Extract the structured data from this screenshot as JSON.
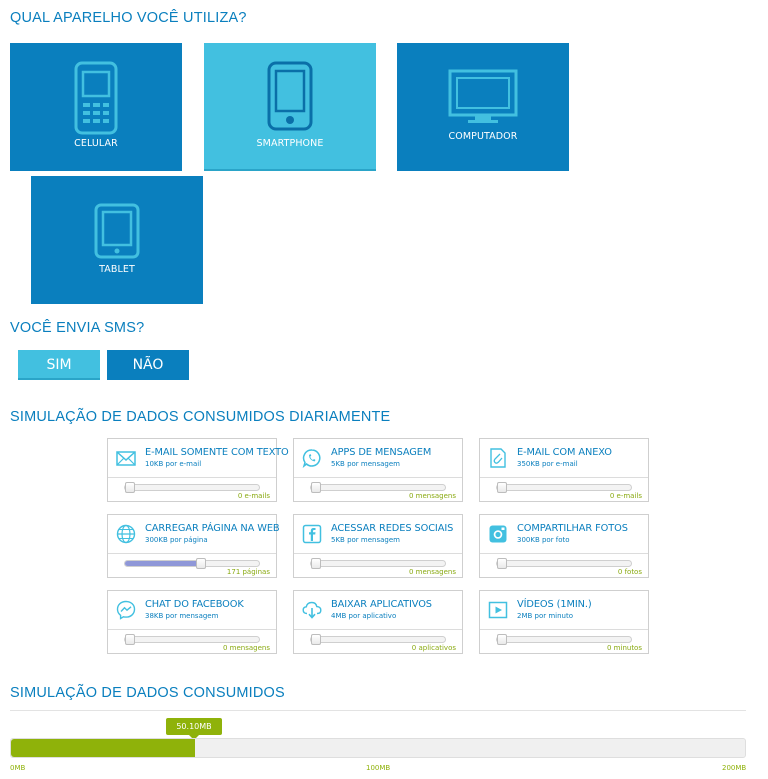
{
  "sections": {
    "device": "QUAL APARELHO VOCÊ UTILIZA?",
    "sms": "VOCÊ ENVIA SMS?",
    "daily": "SIMULAÇÃO DE DADOS CONSUMIDOS DIARIAMENTE",
    "total": "SIMULAÇÃO DE DADOS CONSUMIDOS"
  },
  "devices": [
    {
      "label": "CELULAR",
      "icon": "feature-phone-icon",
      "selected": false
    },
    {
      "label": "SMARTPHONE",
      "icon": "smartphone-icon",
      "selected": true
    },
    {
      "label": "COMPUTADOR",
      "icon": "monitor-icon",
      "selected": false
    },
    {
      "label": "TABLET",
      "icon": "tablet-icon",
      "selected": false
    }
  ],
  "sms": {
    "yes": "SIM",
    "no": "NÃO",
    "selected": "yes"
  },
  "cards": [
    {
      "title": "E-MAIL SOMENTE COM TEXTO",
      "subtitle": "10KB por e-mail",
      "value": "0 e-mails",
      "level": 0,
      "icon": "envelope-icon"
    },
    {
      "title": "APPS DE MENSAGEM",
      "subtitle": "5KB por mensagem",
      "value": "0 mensagens",
      "level": 0,
      "icon": "whatsapp-icon"
    },
    {
      "title": "E-MAIL COM ANEXO",
      "subtitle": "350KB por e-mail",
      "value": "0 e-mails",
      "level": 0,
      "icon": "attachment-icon"
    },
    {
      "title": "CARREGAR PÁGINA NA WEB",
      "subtitle": "300KB por página",
      "value": "171 páginas",
      "level": 0.57,
      "icon": "globe-icon"
    },
    {
      "title": "ACESSAR REDES SOCIAIS",
      "subtitle": "5KB por mensagem",
      "value": "0 mensagens",
      "level": 0,
      "icon": "facebook-icon"
    },
    {
      "title": "COMPARTILHAR FOTOS",
      "subtitle": "300KB por foto",
      "value": "0 fotos",
      "level": 0,
      "icon": "camera-icon"
    },
    {
      "title": "CHAT DO FACEBOOK",
      "subtitle": "38KB por mensagem",
      "value": "0 mensagens",
      "level": 0,
      "icon": "messenger-icon"
    },
    {
      "title": "BAIXAR APLICATIVOS",
      "subtitle": "4MB por aplicativo",
      "value": "0 aplicativos",
      "level": 0,
      "icon": "cloud-download-icon"
    },
    {
      "title": "VÍDEOS (1MIN.)",
      "subtitle": "2MB por minuto",
      "value": "0 minutos",
      "level": 0,
      "icon": "video-play-icon"
    }
  ],
  "total": {
    "value_label": "50.10MB",
    "value_mb": 50.1,
    "max_mb": 200,
    "scale": [
      "0MB",
      "100MB",
      "200MB"
    ]
  },
  "colors": {
    "primary": "#0a7fbe",
    "selected": "#42c0e0",
    "accent_green": "#8fb20a",
    "slider_fill": "#8f97d8"
  }
}
